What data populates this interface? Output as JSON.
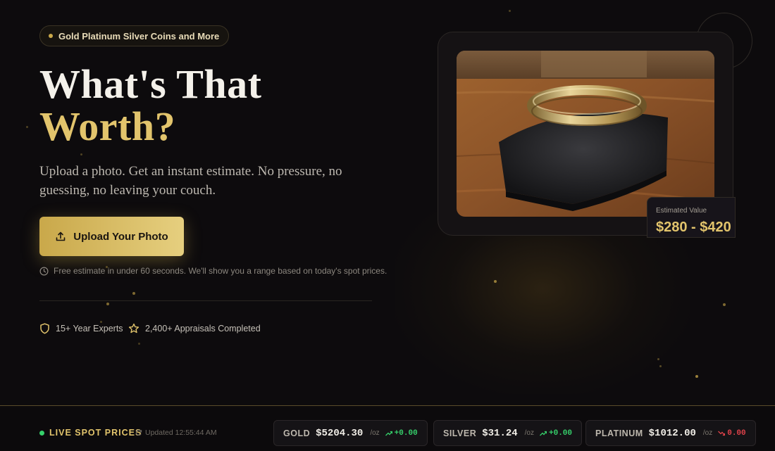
{
  "badge": {
    "label": "Gold Platinum Silver Coins and More"
  },
  "hero": {
    "title_line1": "What's That",
    "title_line2": "Worth?",
    "subtitle": "Upload a photo. Get an instant estimate. No pressure, no guessing, no leaving your couch.",
    "cta_label": "Upload Your Photo",
    "note": "Free estimate in under 60 seconds. We'll show you a range based on today's spot prices."
  },
  "trust": [
    {
      "label": "15+ Year Experts",
      "icon": "shield-icon"
    },
    {
      "label": "2,400+ Appraisals Completed",
      "icon": "star-icon"
    }
  ],
  "estimate": {
    "label": "Estimated Value",
    "value": "$280 - $420"
  },
  "ticker": {
    "live_label": "LIVE SPOT PRICES",
    "updated": "Updated 12:55:44 AM",
    "items": [
      {
        "name": "GOLD",
        "price": "$5204.30",
        "unit": "/oz",
        "change": "+0.00",
        "direction": "up"
      },
      {
        "name": "SILVER",
        "price": "$31.24",
        "unit": "/oz",
        "change": "+0.00",
        "direction": "up"
      },
      {
        "name": "PLATINUM",
        "price": "$1012.00",
        "unit": "/oz",
        "change": "0.00",
        "direction": "down"
      }
    ]
  },
  "colors": {
    "accent": "#e2c46c",
    "up": "#36d06b",
    "down": "#e0424a",
    "background": "#0d0b0d"
  }
}
